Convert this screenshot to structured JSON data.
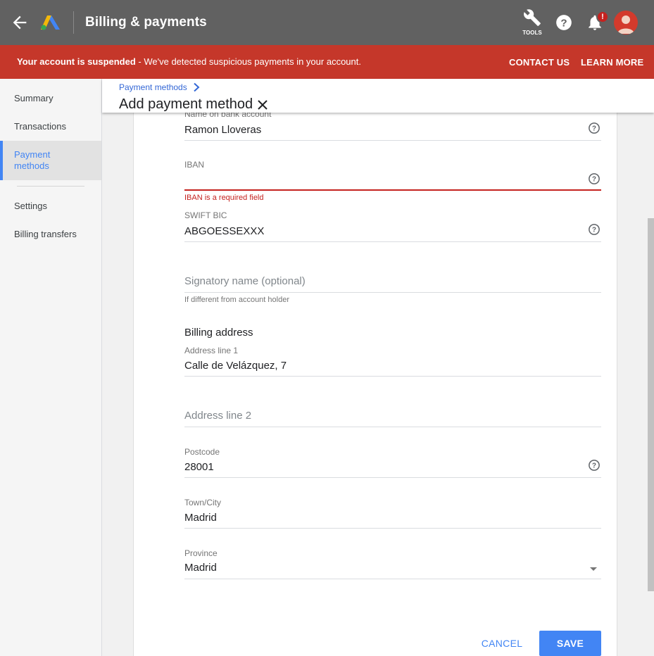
{
  "appbar": {
    "title": "Billing & payments",
    "back_icon": "arrow-back-icon",
    "logo": "google-ads-logo",
    "tools_label": "TOOLS",
    "notification_badge": "!"
  },
  "banner": {
    "bold_text": "Your account is suspended",
    "text": " - We've detected suspicious payments in your account.",
    "contact_label": "CONTACT US",
    "learn_label": "LEARN MORE",
    "color": "#c5372a"
  },
  "sidebar": {
    "items": [
      {
        "label": "Summary"
      },
      {
        "label": "Transactions"
      },
      {
        "label": "Payment methods",
        "active": true
      },
      {
        "label": "Settings"
      },
      {
        "label": "Billing transfers"
      }
    ]
  },
  "header": {
    "breadcrumb": "Payment methods",
    "title": "Add payment method"
  },
  "form": {
    "bank_name": {
      "label": "Name on bank account",
      "value": "Ramon Lloveras"
    },
    "iban": {
      "label": "IBAN",
      "value": "",
      "error": "IBAN is a required field"
    },
    "swift": {
      "label": "SWIFT BIC",
      "value": "ABGOESSEXXX"
    },
    "signatory": {
      "placeholder": "Signatory name (optional)",
      "hint": "If different from account holder"
    },
    "billing_title": "Billing address",
    "address1": {
      "label": "Address line 1",
      "value": "Calle de Velázquez, 7"
    },
    "address2": {
      "placeholder": "Address line 2"
    },
    "postcode": {
      "label": "Postcode",
      "value": "28001"
    },
    "city": {
      "label": "Town/City",
      "value": "Madrid"
    },
    "province": {
      "label": "Province",
      "value": "Madrid"
    }
  },
  "actions": {
    "cancel_label": "CANCEL",
    "save_label": "SAVE",
    "accent": "#4285f4"
  }
}
